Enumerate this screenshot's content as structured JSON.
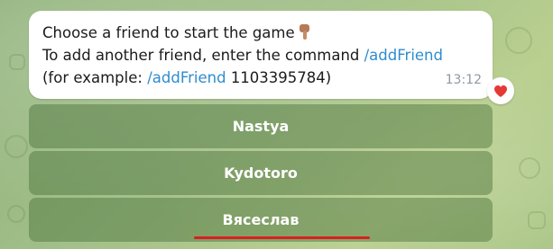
{
  "message": {
    "line1": "Choose a friend to start the game",
    "line2_prefix": "To add another friend, enter the command",
    "line2_command": "/addFriend",
    "line3_prefix": "(for example:",
    "line3_command": "/addFriend",
    "line3_suffix": "1103395784)",
    "time": "13:12",
    "emoji_icon": "pointing-down-hand-icon"
  },
  "reaction": {
    "icon": "heart-icon",
    "color": "#e53935"
  },
  "keyboard": {
    "buttons": [
      {
        "label": "Nastya"
      },
      {
        "label": "Kydotoro"
      },
      {
        "label": "Вясеслав"
      }
    ]
  },
  "colors": {
    "command": "#2f8ccf",
    "annotation_underline": "#d92020",
    "button_bg": "rgba(70,110,55,0.45)"
  }
}
